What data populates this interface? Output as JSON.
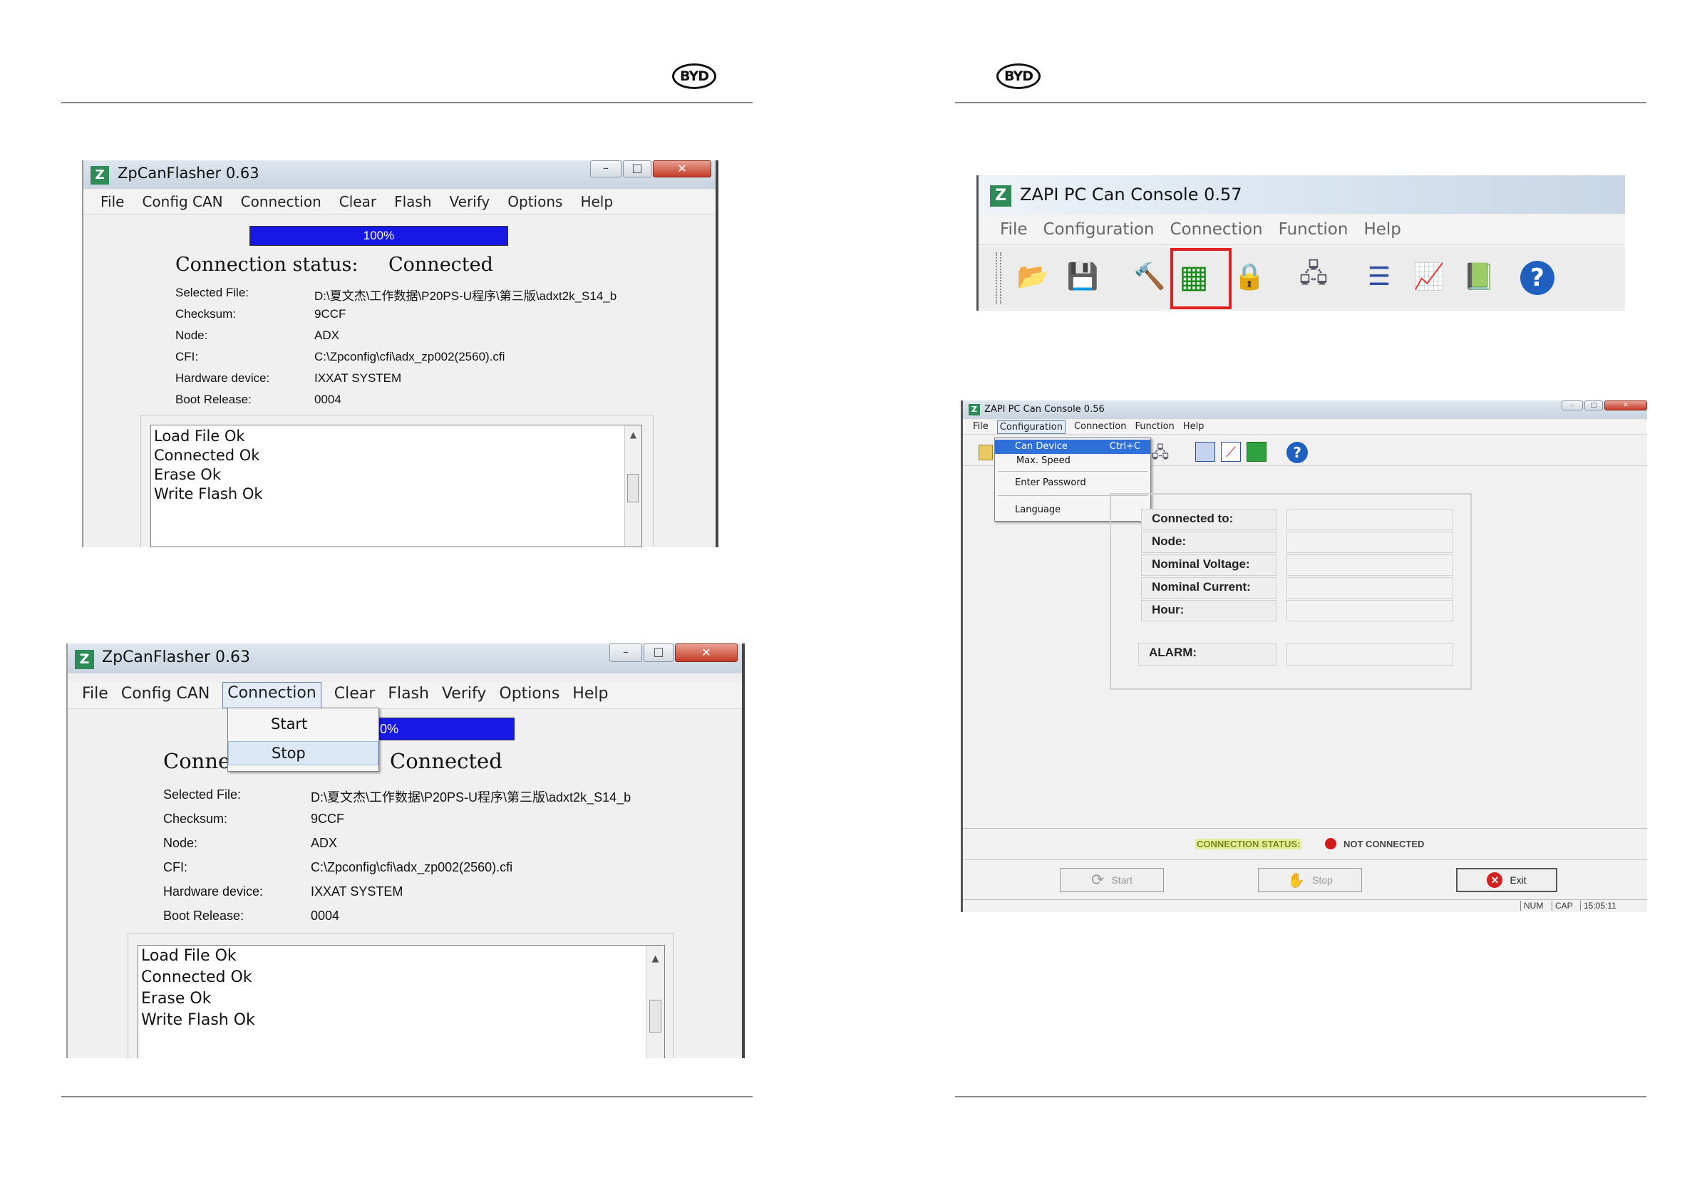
{
  "brand": {
    "logo_text": "BYD"
  },
  "flasher1": {
    "title": "ZpCanFlasher 0.63",
    "menu": [
      "File",
      "Config CAN",
      "Connection",
      "Clear",
      "Flash",
      "Verify",
      "Options",
      "Help"
    ],
    "progress_label": "100%",
    "progress_fraction": 1.0,
    "status_label": "Connection status:",
    "status_value": "Connected",
    "info": [
      {
        "label": "Selected File:",
        "value": "D:\\夏文杰\\工作数据\\P20PS-U程序\\第三版\\adxt2k_S14_b"
      },
      {
        "label": "Checksum:",
        "value": "9CCF"
      },
      {
        "label": "Node:",
        "value": "ADX"
      },
      {
        "label": "CFI:",
        "value": "C:\\Zpconfig\\cfi\\adx_zp002(2560).cfi"
      },
      {
        "label": "Hardware device:",
        "value": "IXXAT SYSTEM"
      },
      {
        "label": "Boot Release:",
        "value": "0004"
      }
    ],
    "log": [
      "Load File Ok",
      "Connected Ok",
      "Erase Ok",
      "Write Flash Ok"
    ]
  },
  "flasher2": {
    "title": "ZpCanFlasher 0.63",
    "menu": [
      "File",
      "Config CAN",
      "Connection",
      "Clear",
      "Flash",
      "Verify",
      "Options",
      "Help"
    ],
    "progress_label": "0%",
    "status_label_partial": "Conne",
    "status_value": "Connected",
    "dropdown": [
      "Start",
      "Stop"
    ],
    "info": [
      {
        "label": "Selected File:",
        "value": "D:\\夏文杰\\工作数据\\P20PS-U程序\\第三版\\adxt2k_S14_b"
      },
      {
        "label": "Checksum:",
        "value": "9CCF"
      },
      {
        "label": "Node:",
        "value": "ADX"
      },
      {
        "label": "CFI:",
        "value": "C:\\Zpconfig\\cfi\\adx_zp002(2560).cfi"
      },
      {
        "label": "Hardware device:",
        "value": "IXXAT SYSTEM"
      },
      {
        "label": "Boot Release:",
        "value": "0004"
      }
    ],
    "log": [
      "Load File Ok",
      "Connected Ok",
      "Erase Ok",
      "Write Flash Ok"
    ]
  },
  "console57": {
    "title": "ZAPI PC Can Console 0.57",
    "menu": [
      "File",
      "Configuration",
      "Connection",
      "Function",
      "Help"
    ],
    "toolbar": [
      {
        "icon": "open-folder-icon",
        "glyph": "📂"
      },
      {
        "icon": "save-icon",
        "glyph": "💾"
      },
      {
        "icon": "tools-icon",
        "glyph": "🔨"
      },
      {
        "icon": "can-device-icon",
        "glyph": "▦",
        "highlighted": true
      },
      {
        "icon": "lock-icon",
        "glyph": "🔒"
      },
      {
        "icon": "network-icon",
        "glyph": "🖧"
      },
      {
        "icon": "list-icon",
        "glyph": "☰"
      },
      {
        "icon": "chart-icon",
        "glyph": "📈"
      },
      {
        "icon": "book-icon",
        "glyph": "📗"
      },
      {
        "icon": "help-icon",
        "glyph": "?"
      }
    ],
    "highlight_color": "#e02020"
  },
  "console56": {
    "title": "ZAPI PC Can Console 0.56",
    "menu": [
      "File",
      "Configuration",
      "Connection",
      "Function",
      "Help"
    ],
    "dropdown": [
      {
        "label": "Can Device",
        "shortcut": "Ctrl+C"
      },
      {
        "label": "Max. Speed",
        "shortcut": ""
      },
      {
        "label": "Enter Password",
        "shortcut": ""
      },
      {
        "label": "Language",
        "shortcut": ""
      }
    ],
    "fields": [
      "Connected to:",
      "Node:",
      "Nominal Voltage:",
      "Nominal Current:",
      "Hour:",
      "ALARM:"
    ],
    "connection_status_label": "CONNECTION STATUS:",
    "connection_status_value": "NOT CONNECTED",
    "status_dot_color": "#d11a1a",
    "buttons": {
      "start": "Start",
      "stop": "Stop",
      "exit": "Exit"
    },
    "statusbar": [
      "NUM",
      "CAP",
      "15:05:11"
    ]
  }
}
